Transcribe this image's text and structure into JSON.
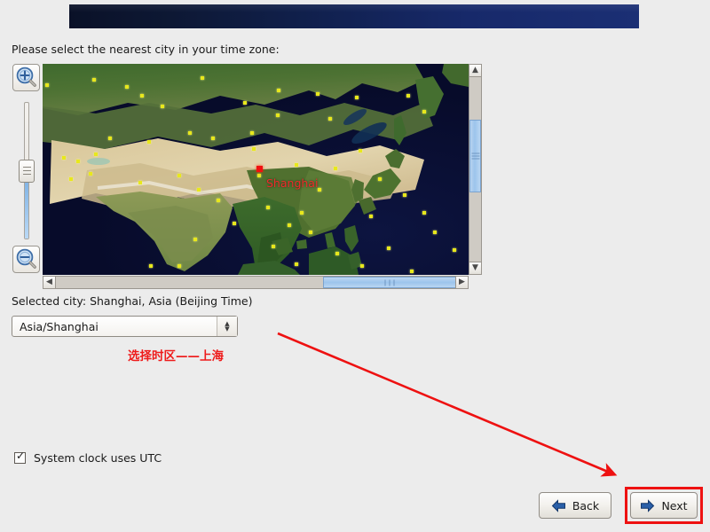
{
  "window": {
    "banner_accent_left": "#0a1128",
    "banner_accent_right": "#1b2f74",
    "background": "#ececec"
  },
  "prompt": {
    "text": "Please select the nearest city in your time zone:"
  },
  "map": {
    "selected_city_marker_label": "Shanghai",
    "zoom_in_icon": "magnifier-plus-icon",
    "zoom_out_icon": "magnifier-minus-icon",
    "vertical_scroll_up_icon": "chevron-up-icon",
    "vertical_scroll_down_icon": "chevron-down-icon",
    "horizontal_scroll_left_icon": "chevron-left-icon",
    "horizontal_scroll_right_icon": "chevron-right-icon",
    "city_dot_color": "#e8e81c",
    "selected_marker_color": "#f01010"
  },
  "selection": {
    "selected_city_text": "Selected city: Shanghai, Asia (Beijing Time)",
    "timezone_value": "Asia/Shanghai",
    "combo_icon": "updown-chevron-icon"
  },
  "annotation": {
    "note_text": "选择时区——上海",
    "note_color": "#ee1b1b",
    "arrow_color": "#ee1111",
    "highlight_color": "#ee1111"
  },
  "options": {
    "utc_checkbox_label": "System clock uses UTC",
    "utc_checkbox_checked": "☑",
    "utc_checkbox_mark": "✓"
  },
  "footer": {
    "back_label": "Back",
    "next_label": "Next",
    "back_icon": "arrow-left-icon",
    "next_icon": "arrow-right-icon"
  }
}
